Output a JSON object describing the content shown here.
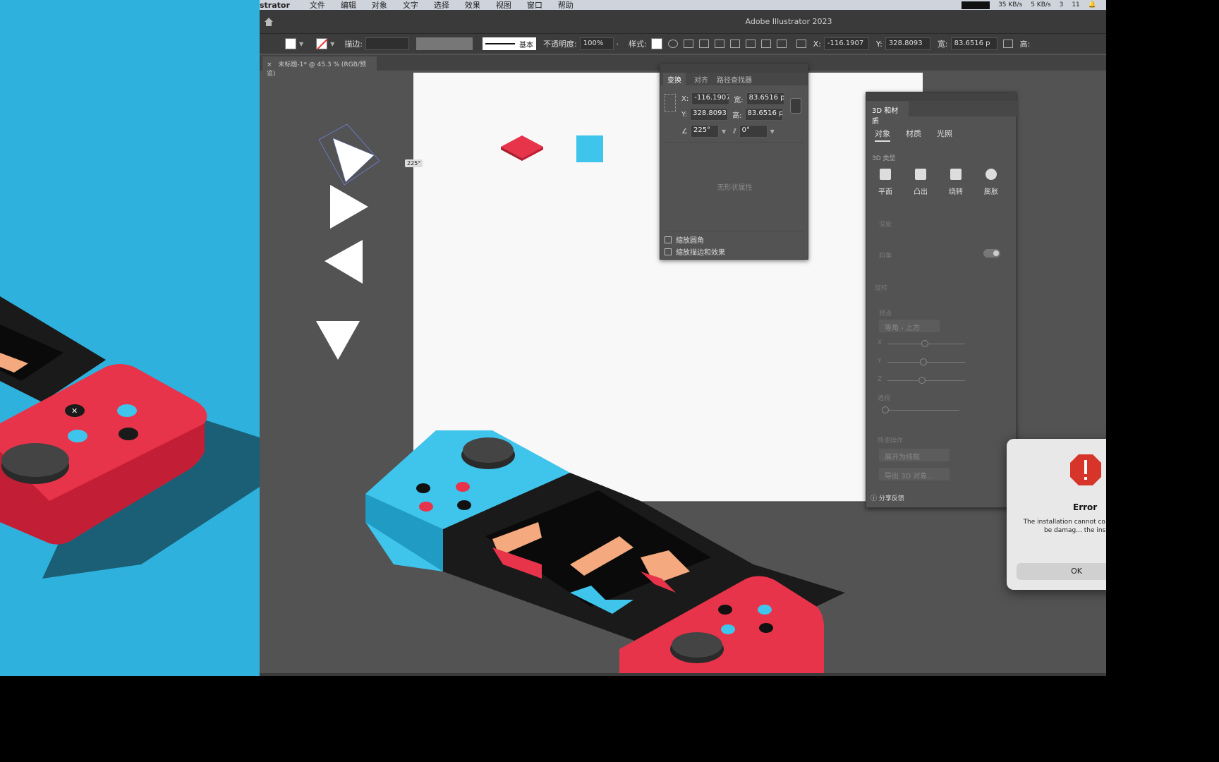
{
  "menubar": {
    "app": "strator",
    "items": [
      "文件",
      "编辑",
      "对象",
      "文字",
      "选择",
      "效果",
      "视图",
      "窗口",
      "帮助"
    ],
    "tray": {
      "net_up": "35 KB/s",
      "net_down": "5 KB/s",
      "wechat_count": "3",
      "qq_count": "11"
    }
  },
  "window": {
    "title": "Adobe Illustrator 2023"
  },
  "controlbar": {
    "stroke_label": "描边:",
    "stroke_profile": "基本",
    "opacity_label": "不透明度:",
    "opacity_value": "100%",
    "style_label": "样式:",
    "x_label": "X:",
    "x_value": "-116.1907",
    "y_label": "Y:",
    "y_value": "328.8093",
    "w_label": "宽:",
    "w_value": "83.6516 p",
    "h_label": "高:"
  },
  "doc_tab": {
    "close": "×",
    "label": "未标题-1* @ 45.3 % (RGB/预览)"
  },
  "canvas": {
    "rotation_tooltip": "225°"
  },
  "transform_panel": {
    "tabs": [
      "变换",
      "对齐",
      "路径查找器"
    ],
    "x_label": "X:",
    "x_value": "-116.1907",
    "y_label": "Y:",
    "y_value": "328.8093",
    "w_label": "宽:",
    "w_value": "83.6516 p",
    "h_label": "高:",
    "h_value": "83.6516 p",
    "angle_value": "225°",
    "shear_value": "0°",
    "empty_text": "无形状属性",
    "check_corners": "缩放圆角",
    "check_strokes": "缩放描边和效果"
  },
  "panel_3d": {
    "title": "3D 和材质",
    "tabs": [
      "对象",
      "材质",
      "光照"
    ],
    "type_section": "3D 类型",
    "types": [
      "平面",
      "凸出",
      "绕转",
      "膨胀"
    ],
    "depth_label": "深度",
    "bevel_label": "斜角",
    "rotation_section": "旋转",
    "preset_label": "预设",
    "preset_value": "等角 - 上方",
    "axis_labels": [
      "X",
      "Y",
      "Z"
    ],
    "perspective_label": "透视",
    "quick_actions": "快速操作",
    "btn_expand": "展开为线框",
    "btn_export": "导出 3D 对象...",
    "feedback": "分享反馈"
  },
  "error_dialog": {
    "title": "Error",
    "message": "The installation cannot co... installer file may be damag... the installer file a...",
    "ok": "OK"
  },
  "colors": {
    "red": "#e8344a",
    "cyan": "#3fc4ec",
    "ref_bg": "#2eb1dc",
    "dark": "#1a1a1a",
    "peach": "#f4a97f"
  }
}
